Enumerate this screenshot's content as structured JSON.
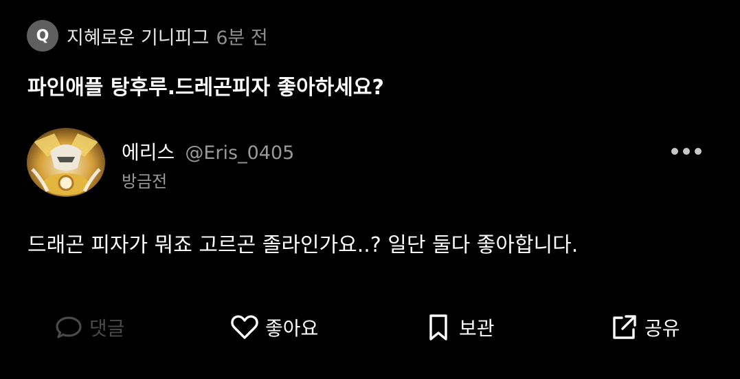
{
  "question": {
    "badge_letter": "Q",
    "asker_name": "지혜로운 기니피그",
    "time": "6분 전",
    "text": "파인애플 탕후루.드레곤피자 좋아하세요?"
  },
  "answer": {
    "author_name": "에리스",
    "author_handle": "@Eris_0405",
    "time": "방금전",
    "text": "드래곤 피자가 뭐죠 고르곤 졸라인가요..? 일단 둘다 좋아합니다."
  },
  "actions": {
    "comment_label": "댓글",
    "like_label": "좋아요",
    "save_label": "보관",
    "share_label": "공유"
  },
  "icons": {
    "more": "more-horizontal-icon",
    "comment": "comment-bubble-icon",
    "like": "heart-icon",
    "save": "bookmark-icon",
    "share": "share-external-icon"
  },
  "colors": {
    "background": "#000000",
    "text_primary": "#ffffff",
    "text_secondary": "#9a9a9a",
    "badge_bg": "#5f5f5f",
    "disabled": "#4a4a4a"
  }
}
